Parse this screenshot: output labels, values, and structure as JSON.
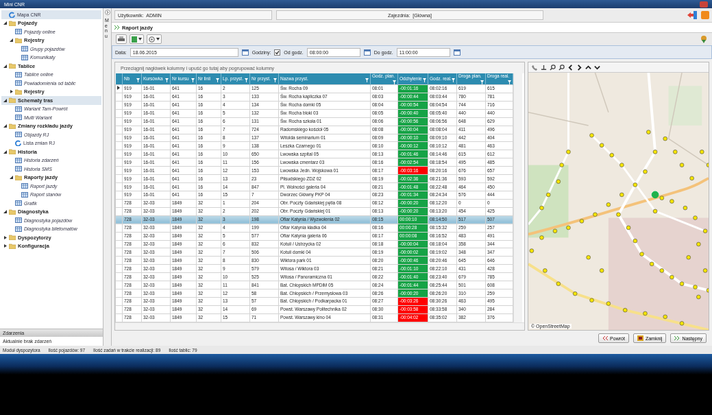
{
  "window": {
    "title": "Mini CNR"
  },
  "sidebar": {
    "items": [
      {
        "label": "Mapa CNR",
        "kind": "map",
        "selected": true
      },
      {
        "label": "Pojazdy",
        "kind": "folder",
        "expanded": true,
        "selected": false,
        "children": [
          {
            "label": "Pojazdy online",
            "kind": "view",
            "selected": false
          },
          {
            "label": "Rejestry",
            "kind": "folder",
            "expanded": true,
            "selected": false,
            "children": [
              {
                "label": "Grupy pojazdów",
                "kind": "view",
                "selected": false
              },
              {
                "label": "Komunikaty",
                "kind": "view",
                "selected": false
              }
            ]
          }
        ]
      },
      {
        "label": "Tablice",
        "kind": "folder",
        "expanded": true,
        "selected": false,
        "children": [
          {
            "label": "Tablice online",
            "kind": "view",
            "selected": false
          },
          {
            "label": "Powiadomienia od tablic",
            "kind": "view",
            "selected": false
          },
          {
            "label": "Rejestry",
            "kind": "folder",
            "expanded": false,
            "selected": false
          }
        ]
      },
      {
        "label": "Schematy tras",
        "kind": "folder",
        "expanded": true,
        "selected": true,
        "children": [
          {
            "label": "Wariant Tam-Powrót",
            "kind": "view",
            "selected": false
          },
          {
            "label": "Multi Wariant",
            "kind": "view",
            "selected": false
          }
        ]
      },
      {
        "label": "Zmiany rozkładu jazdy",
        "kind": "folder",
        "expanded": true,
        "selected": false,
        "children": [
          {
            "label": "Objazdy RJ",
            "kind": "view",
            "selected": false
          },
          {
            "label": "Lista zmian RJ",
            "kind": "map",
            "selected": false
          }
        ]
      },
      {
        "label": "Historia",
        "kind": "folder",
        "expanded": true,
        "selected": false,
        "children": [
          {
            "label": "Historia zdarzeń",
            "kind": "view",
            "selected": false
          },
          {
            "label": "Historia SMS",
            "kind": "view",
            "selected": false
          },
          {
            "label": "Raporty jazdy",
            "kind": "folder",
            "expanded": true,
            "selected": false,
            "children": [
              {
                "label": "Raport jazdy",
                "kind": "view",
                "selected": false
              },
              {
                "label": "Raport stanów",
                "kind": "view",
                "selected": false
              }
            ]
          },
          {
            "label": "Grafik",
            "kind": "view",
            "selected": false
          }
        ]
      },
      {
        "label": "Diagnostyka",
        "kind": "folder",
        "expanded": true,
        "selected": false,
        "children": [
          {
            "label": "Diagnostyka pojazdów",
            "kind": "view",
            "selected": false
          },
          {
            "label": "Diagnostyka biletomatów",
            "kind": "view",
            "selected": false
          }
        ]
      },
      {
        "label": "Dyspozytorzy",
        "kind": "folder",
        "expanded": false,
        "selected": false
      },
      {
        "label": "Konfiguracja",
        "kind": "folder",
        "expanded": false,
        "selected": false
      }
    ]
  },
  "events": {
    "title": "Zdarzenia",
    "message": "Aktualnie brak zdarzeń"
  },
  "menu_tab": "Menu",
  "info_bar": {
    "user_label": "Użytkownik:",
    "user": "ADMIN",
    "depot_label": "Zajezdnia:",
    "depot": "[Główna]"
  },
  "page_title": "Raport jazdy",
  "filter": {
    "date_label": "Data:",
    "date": "18.06.2015",
    "hours_label": "Godziny:",
    "hours_checked": true,
    "from_label": "Od godz.",
    "from": "08:00:00",
    "to_label": "Do godz.",
    "to": "11:00:00"
  },
  "group_hint": "Przeciągnij nagłówek kolumny i upuść go tutaj aby pogrupować kolumny",
  "table": {
    "columns": [
      "Nb",
      "Kursówka",
      "Nr kursu",
      "Nr linii",
      "Lp. przyst.",
      "Nr przyst.",
      "Nazwa przyst.",
      "Godz. plan.",
      "Odchylenie",
      "Godz. real.",
      "Droga plan.",
      "Droga real."
    ],
    "rows": [
      {
        "cells": [
          "919",
          "16-01",
          "641",
          "16",
          "2",
          "125",
          "Św. Rocha 09",
          "08:01",
          "-00:01:16",
          "08:02:16",
          "619",
          "615"
        ],
        "color": "#16a346",
        "selected": false,
        "current": true
      },
      {
        "cells": [
          "919",
          "16-01",
          "641",
          "16",
          "3",
          "133",
          "Św. Rocha kapliczka 07",
          "08:03",
          "-00:00:44",
          "08:03:44",
          "780",
          "781"
        ],
        "color": "#16a346",
        "selected": false,
        "current": false
      },
      {
        "cells": [
          "919",
          "16-01",
          "641",
          "16",
          "4",
          "134",
          "Św. Rocha domki 05",
          "08:04",
          "-00:00:54",
          "08:04:54",
          "744",
          "716"
        ],
        "color": "#16a346",
        "selected": false,
        "current": false
      },
      {
        "cells": [
          "919",
          "16-01",
          "641",
          "16",
          "5",
          "132",
          "Św. Rocha bloki 03",
          "08:05",
          "-00:00:40",
          "08:05:40",
          "440",
          "440"
        ],
        "color": "#16a346",
        "selected": false,
        "current": false
      },
      {
        "cells": [
          "919",
          "16-01",
          "641",
          "16",
          "6",
          "131",
          "Św. Rocha szkoła 01",
          "08:06",
          "-00:00:56",
          "08:06:56",
          "648",
          "629"
        ],
        "color": "#16a346",
        "selected": false,
        "current": false
      },
      {
        "cells": [
          "919",
          "16-01",
          "641",
          "16",
          "7",
          "724",
          "Radomskiego kościół 05",
          "08:08",
          "-00:00:04",
          "08:08:04",
          "411",
          "496"
        ],
        "color": "#16a346",
        "selected": false,
        "current": false
      },
      {
        "cells": [
          "919",
          "16-01",
          "641",
          "16",
          "8",
          "137",
          "Witolda seminarium 01",
          "08:09",
          "-00:00:10",
          "08:09:10",
          "442",
          "404"
        ],
        "color": "#16a346",
        "selected": false,
        "current": false
      },
      {
        "cells": [
          "919",
          "16-01",
          "641",
          "16",
          "9",
          "138",
          "Leszka Czarnego 01",
          "08:10",
          "-00:00:12",
          "08:10:12",
          "481",
          "463"
        ],
        "color": "#16a346",
        "selected": false,
        "current": false
      },
      {
        "cells": [
          "919",
          "16-01",
          "641",
          "16",
          "10",
          "650",
          "Lwowska szpital 05",
          "08:13",
          "-00:01:46",
          "08:14:46",
          "615",
          "612"
        ],
        "color": "#16a346",
        "selected": false,
        "current": false
      },
      {
        "cells": [
          "919",
          "16-01",
          "641",
          "16",
          "11",
          "156",
          "Lwowska cmentarz 03",
          "08:16",
          "-00:02:54",
          "08:18:54",
          "495",
          "485"
        ],
        "color": "#16a346",
        "selected": false,
        "current": false
      },
      {
        "cells": [
          "919",
          "16-01",
          "641",
          "16",
          "12",
          "153",
          "Lwowska Jedn. Wojskowa 01",
          "08:17",
          "-00:03:16",
          "08:20:16",
          "676",
          "657"
        ],
        "color": "#ff0000",
        "selected": false,
        "current": false
      },
      {
        "cells": [
          "919",
          "16-01",
          "641",
          "16",
          "13",
          "23",
          "Piłsudskiego ZDZ 02",
          "08:19",
          "-00:02:36",
          "08:21:36",
          "593",
          "592"
        ],
        "color": "#16a346",
        "selected": false,
        "current": false
      },
      {
        "cells": [
          "919",
          "16-01",
          "641",
          "16",
          "14",
          "847",
          "Pl. Wolności galeria 04",
          "08:21",
          "-00:01:48",
          "08:22:48",
          "464",
          "450"
        ],
        "color": "#16a346",
        "selected": false,
        "current": false
      },
      {
        "cells": [
          "919",
          "16-01",
          "641",
          "16",
          "15",
          "7",
          "Dworzec Główny PKP 04",
          "08:23",
          "-00:01:34",
          "08:24:34",
          "576",
          "444"
        ],
        "color": "#16a346",
        "selected": false,
        "current": false
      },
      {
        "cells": [
          "728",
          "32-03",
          "1849",
          "32",
          "1",
          "204",
          "Obr. Poczty Gdańskiej pętla 08",
          "08:12",
          "-00:00:20",
          "08:12:20",
          "0",
          "0"
        ],
        "color": "#16a346",
        "selected": false,
        "current": false
      },
      {
        "cells": [
          "728",
          "32-03",
          "1849",
          "32",
          "2",
          "202",
          "Obr. Poczty Gdańskiej 01",
          "08:13",
          "-00:00:20",
          "08:13:20",
          "454",
          "425"
        ],
        "color": "#16a346",
        "selected": false,
        "current": false
      },
      {
        "cells": [
          "728",
          "32-03",
          "1849",
          "32",
          "3",
          "198",
          "Ofiar Katynia / Wyzwolenia 02",
          "08:15",
          "00:00:10",
          "08:14:50",
          "517",
          "507"
        ],
        "color": "#16a346",
        "selected": true,
        "current": false
      },
      {
        "cells": [
          "728",
          "32-03",
          "1849",
          "32",
          "4",
          "199",
          "Ofiar Katynia kładka 04",
          "08:16",
          "00:00:28",
          "08:15:32",
          "259",
          "257"
        ],
        "color": "#16a346",
        "selected": false,
        "current": false
      },
      {
        "cells": [
          "728",
          "32-03",
          "1849",
          "32",
          "5",
          "577",
          "Ofiar Katynia galeria 06",
          "08:17",
          "00:00:08",
          "08:16:52",
          "483",
          "491"
        ],
        "color": "#16a346",
        "selected": false,
        "current": false
      },
      {
        "cells": [
          "728",
          "32-03",
          "1849",
          "32",
          "6",
          "832",
          "Kotuli / Ustrzycka 02",
          "08:18",
          "-00:00:04",
          "08:18:04",
          "358",
          "344"
        ],
        "color": "#16a346",
        "selected": false,
        "current": false
      },
      {
        "cells": [
          "728",
          "32-03",
          "1849",
          "32",
          "7",
          "506",
          "Kotuli domki 04",
          "08:19",
          "-00:00:02",
          "08:19:02",
          "348",
          "347"
        ],
        "color": "#16a346",
        "selected": false,
        "current": false
      },
      {
        "cells": [
          "728",
          "32-03",
          "1849",
          "32",
          "8",
          "830",
          "Wiktora park 01",
          "08:20",
          "-00:00:46",
          "08:20:46",
          "645",
          "646"
        ],
        "color": "#16a346",
        "selected": false,
        "current": false
      },
      {
        "cells": [
          "728",
          "32-03",
          "1849",
          "32",
          "9",
          "579",
          "Witosa / Wiktora 03",
          "08:21",
          "-00:01:10",
          "08:22:10",
          "431",
          "428"
        ],
        "color": "#16a346",
        "selected": false,
        "current": false
      },
      {
        "cells": [
          "728",
          "32-03",
          "1849",
          "32",
          "10",
          "525",
          "Witosa / Panoramiczna 01",
          "08:22",
          "-00:01:40",
          "08:23:40",
          "679",
          "785"
        ],
        "color": "#16a346",
        "selected": false,
        "current": false
      },
      {
        "cells": [
          "728",
          "32-03",
          "1849",
          "32",
          "11",
          "841",
          "Bat. Chłopskich MPDiM 05",
          "08:24",
          "-00:01:44",
          "08:25:44",
          "501",
          "608"
        ],
        "color": "#16a346",
        "selected": false,
        "current": false
      },
      {
        "cells": [
          "728",
          "32-03",
          "1849",
          "32",
          "12",
          "58",
          "Bat. Chłopskich / Przemysłowa 03",
          "08:26",
          "-00:00:20",
          "08:26:20",
          "310",
          "259"
        ],
        "color": "#16a346",
        "selected": false,
        "current": false
      },
      {
        "cells": [
          "728",
          "32-03",
          "1849",
          "32",
          "13",
          "57",
          "Bat. Chłopskich / Podkarpacka 01",
          "08:27",
          "-00:03:26",
          "08:30:26",
          "463",
          "495"
        ],
        "color": "#ff0000",
        "selected": false,
        "current": false
      },
      {
        "cells": [
          "728",
          "32-03",
          "1849",
          "32",
          "14",
          "69",
          "Powst. Warszawy Politechnika 02",
          "08:30",
          "-00:03:58",
          "08:33:58",
          "340",
          "284"
        ],
        "color": "#ff0000",
        "selected": false,
        "current": false
      },
      {
        "cells": [
          "728",
          "32-03",
          "1849",
          "32",
          "15",
          "71",
          "Powst. Warszawy kino 04",
          "08:31",
          "-00:04:02",
          "08:35:02",
          "382",
          "376"
        ],
        "color": "#ff0000",
        "selected": false,
        "current": false
      }
    ]
  },
  "map": {
    "attribution": "© OpenStreetMap"
  },
  "buttons": [
    "Powrót",
    "Zamknij",
    "Następny"
  ],
  "status_bar": [
    "Moduł dyspozytora",
    "Ilość pojazdów: 97",
    "Ilość zadań w trakcie realizacji: 89",
    "Ilość tablic: 79"
  ]
}
